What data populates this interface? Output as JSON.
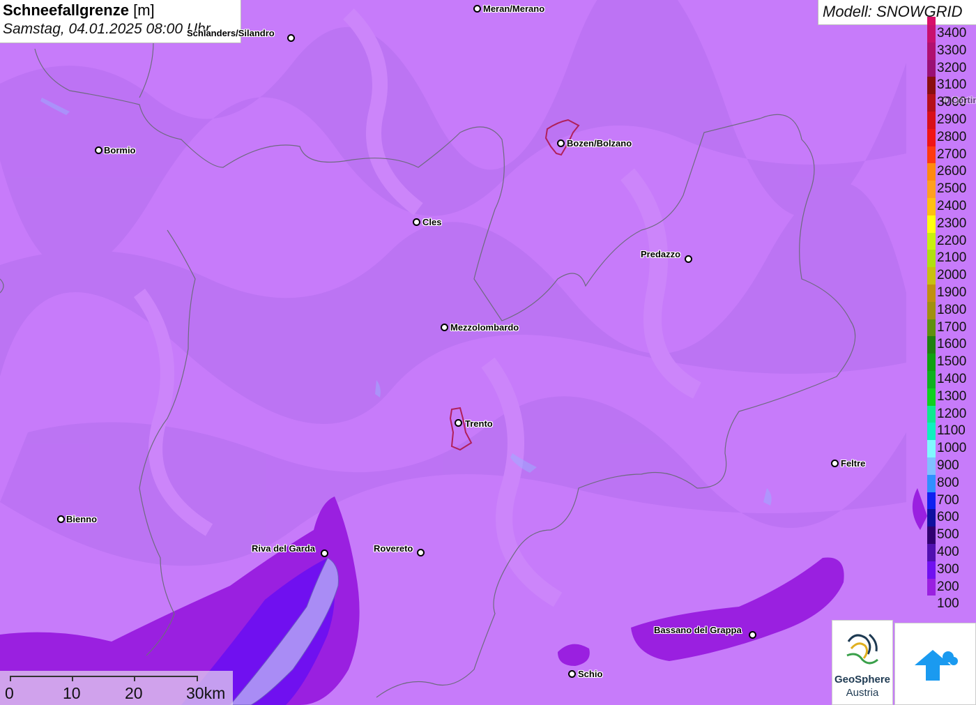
{
  "title": {
    "main": "Schneefallgrenze",
    "unit": "[m]",
    "datetime": "Samstag, 04.01.2025 08:00 Uhr"
  },
  "model_label": "Modell: SNOWGRID",
  "legend": {
    "entries": [
      {
        "label": "3400",
        "color": "#c8106e"
      },
      {
        "label": "3300",
        "color": "#b01070"
      },
      {
        "label": "3200",
        "color": "#9a1075"
      },
      {
        "label": "3100",
        "color": "#8a0e10"
      },
      {
        "label": "3000",
        "color": "#b5101a"
      },
      {
        "label": "2900",
        "color": "#d8101a"
      },
      {
        "label": "2800",
        "color": "#f01515"
      },
      {
        "label": "2700",
        "color": "#ff3a10"
      },
      {
        "label": "2600",
        "color": "#ff8a10"
      },
      {
        "label": "2500",
        "color": "#ffa020"
      },
      {
        "label": "2400",
        "color": "#ffc010"
      },
      {
        "label": "2300",
        "color": "#ffff10"
      },
      {
        "label": "2200",
        "color": "#c8f010"
      },
      {
        "label": "2100",
        "color": "#b0e010"
      },
      {
        "label": "2000",
        "color": "#c8c010"
      },
      {
        "label": "1900",
        "color": "#c09010"
      },
      {
        "label": "1800",
        "color": "#a09010"
      },
      {
        "label": "1700",
        "color": "#609010"
      },
      {
        "label": "1600",
        "color": "#208010"
      },
      {
        "label": "1500",
        "color": "#10a010"
      },
      {
        "label": "1400",
        "color": "#10b020"
      },
      {
        "label": "1300",
        "color": "#10d020"
      },
      {
        "label": "1200",
        "color": "#10e890"
      },
      {
        "label": "1100",
        "color": "#10f0c0"
      },
      {
        "label": "1000",
        "color": "#80f8ff"
      },
      {
        "label": "900",
        "color": "#80c0ff"
      },
      {
        "label": "800",
        "color": "#3090ff"
      },
      {
        "label": "700",
        "color": "#1020f0"
      },
      {
        "label": "600",
        "color": "#1010a0"
      },
      {
        "label": "500",
        "color": "#300070"
      },
      {
        "label": "400",
        "color": "#5010b0"
      },
      {
        "label": "300",
        "color": "#7010f0"
      },
      {
        "label": "200",
        "color": "#9a20e0"
      },
      {
        "label": "100",
        "color": "#c77bfa"
      }
    ]
  },
  "scalebar": {
    "labels": [
      "0",
      "10",
      "20",
      "30km"
    ]
  },
  "cities": [
    {
      "name": "Meran/Merano"
    },
    {
      "name": "Schlanders/Silandro"
    },
    {
      "name": "Bormio"
    },
    {
      "name": "Bozen/Bolzano"
    },
    {
      "name": "Cles"
    },
    {
      "name": "Predazzo"
    },
    {
      "name": "Mezzolombardo"
    },
    {
      "name": "Trento"
    },
    {
      "name": "Feltre"
    },
    {
      "name": "Bienno"
    },
    {
      "name": "Riva del Garda"
    },
    {
      "name": "Rovereto"
    },
    {
      "name": "Bassano del Grappa"
    },
    {
      "name": "Schio"
    },
    {
      "name": "Cortina"
    }
  ],
  "logos": {
    "geosphere_line1": "GeoSphere",
    "geosphere_line2": "Austria"
  }
}
